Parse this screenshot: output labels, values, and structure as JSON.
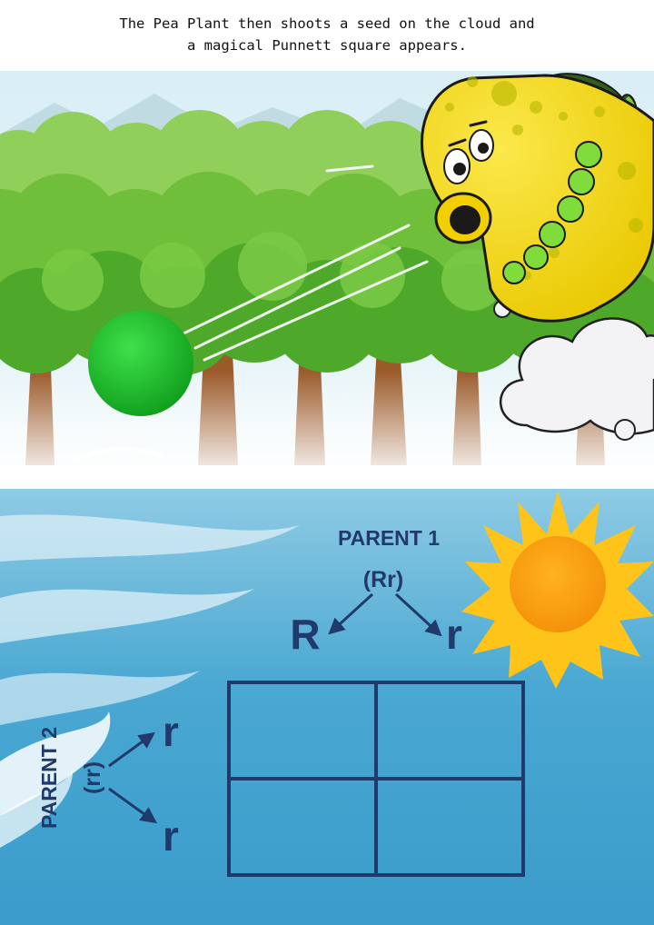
{
  "caption": {
    "line1": "The Pea Plant then shoots a seed on the cloud and",
    "line2": "a magical Punnett square appears."
  },
  "punnett": {
    "parent1_label": "PARENT 1",
    "parent1_genotype": "(Rr)",
    "parent1_alleles": [
      "R",
      "r"
    ],
    "parent2_label": "PARENT 2",
    "parent2_genotype": "(rr)",
    "parent2_alleles": [
      "r",
      "r"
    ]
  },
  "colors": {
    "ink": "#1f3a6b",
    "sky": "#3fa0cf",
    "sun": "#ffc41a",
    "pea": "#f7dc1e",
    "seed": "#22c42e"
  }
}
